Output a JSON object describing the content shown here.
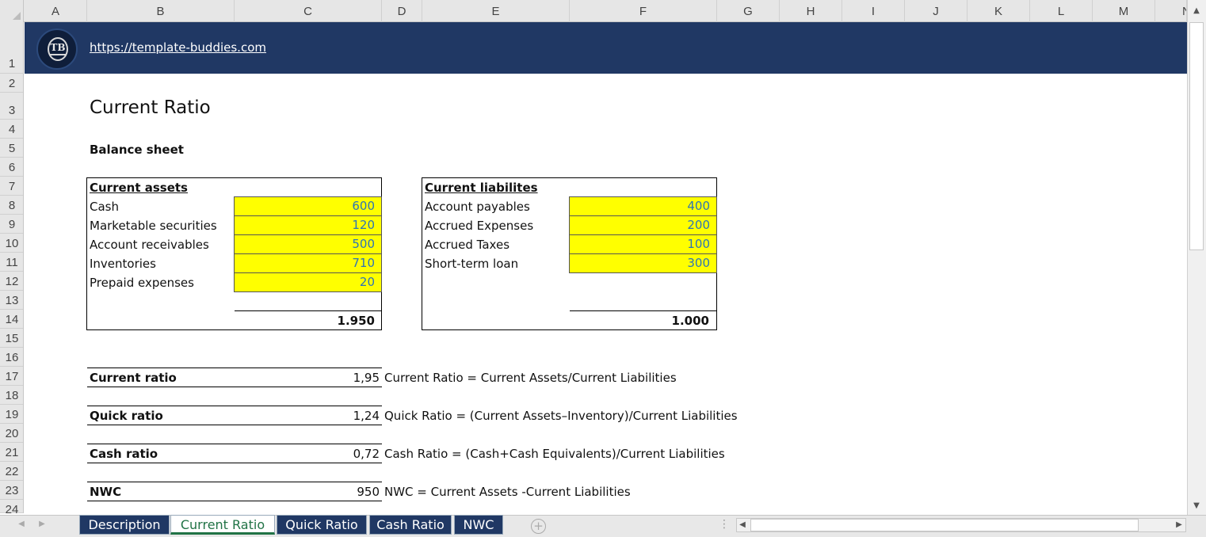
{
  "columns": [
    "A",
    "B",
    "C",
    "D",
    "E",
    "F",
    "G",
    "H",
    "I",
    "J",
    "K",
    "L",
    "M",
    "N"
  ],
  "rows": [
    "1",
    "2",
    "3",
    "4",
    "5",
    "6",
    "7",
    "8",
    "9",
    "10",
    "11",
    "12",
    "13",
    "14",
    "15",
    "16",
    "17",
    "18",
    "19",
    "20",
    "21",
    "22",
    "23",
    "24"
  ],
  "banner": {
    "url": "https://template-buddies.com",
    "logo_text": "TB"
  },
  "title": "Current Ratio",
  "balance_sheet_label": "Balance sheet",
  "assets": {
    "header": "Current assets",
    "items": [
      {
        "label": "Cash",
        "value": "600"
      },
      {
        "label": "Marketable securities",
        "value": "120"
      },
      {
        "label": "Account receivables",
        "value": "500"
      },
      {
        "label": "Inventories",
        "value": "710"
      },
      {
        "label": "Prepaid expenses",
        "value": "20"
      }
    ],
    "total": "1.950"
  },
  "liabilities": {
    "header": "Current liabilites",
    "items": [
      {
        "label": "Account payables",
        "value": "400"
      },
      {
        "label": "Accrued Expenses",
        "value": "200"
      },
      {
        "label": "Accrued Taxes",
        "value": "100"
      },
      {
        "label": "Short-term loan",
        "value": "300"
      }
    ],
    "total": "1.000"
  },
  "ratios": [
    {
      "label": "Current ratio",
      "value": "1,95",
      "formula": "Current Ratio = Current Assets/Current Liabilities"
    },
    {
      "label": "Quick ratio",
      "value": "1,24",
      "formula": "Quick Ratio = (Current Assets–Inventory)/Current Liabilities"
    },
    {
      "label": "Cash ratio",
      "value": "0,72",
      "formula": "Cash Ratio = (Cash+Cash Equivalents)/Current Liabilities"
    },
    {
      "label": "NWC",
      "value": "950",
      "formula": "NWC = Current Assets -Current Liabilities"
    }
  ],
  "sheet_tabs": [
    {
      "label": "Description",
      "active": false
    },
    {
      "label": "Current Ratio",
      "active": true
    },
    {
      "label": "Quick Ratio",
      "active": false
    },
    {
      "label": "Cash Ratio",
      "active": false
    },
    {
      "label": "NWC",
      "active": false
    }
  ],
  "colors": {
    "banner": "#203864",
    "input_fill": "#ffff00",
    "input_text": "#2e74b5",
    "active_tab": "#217346"
  }
}
